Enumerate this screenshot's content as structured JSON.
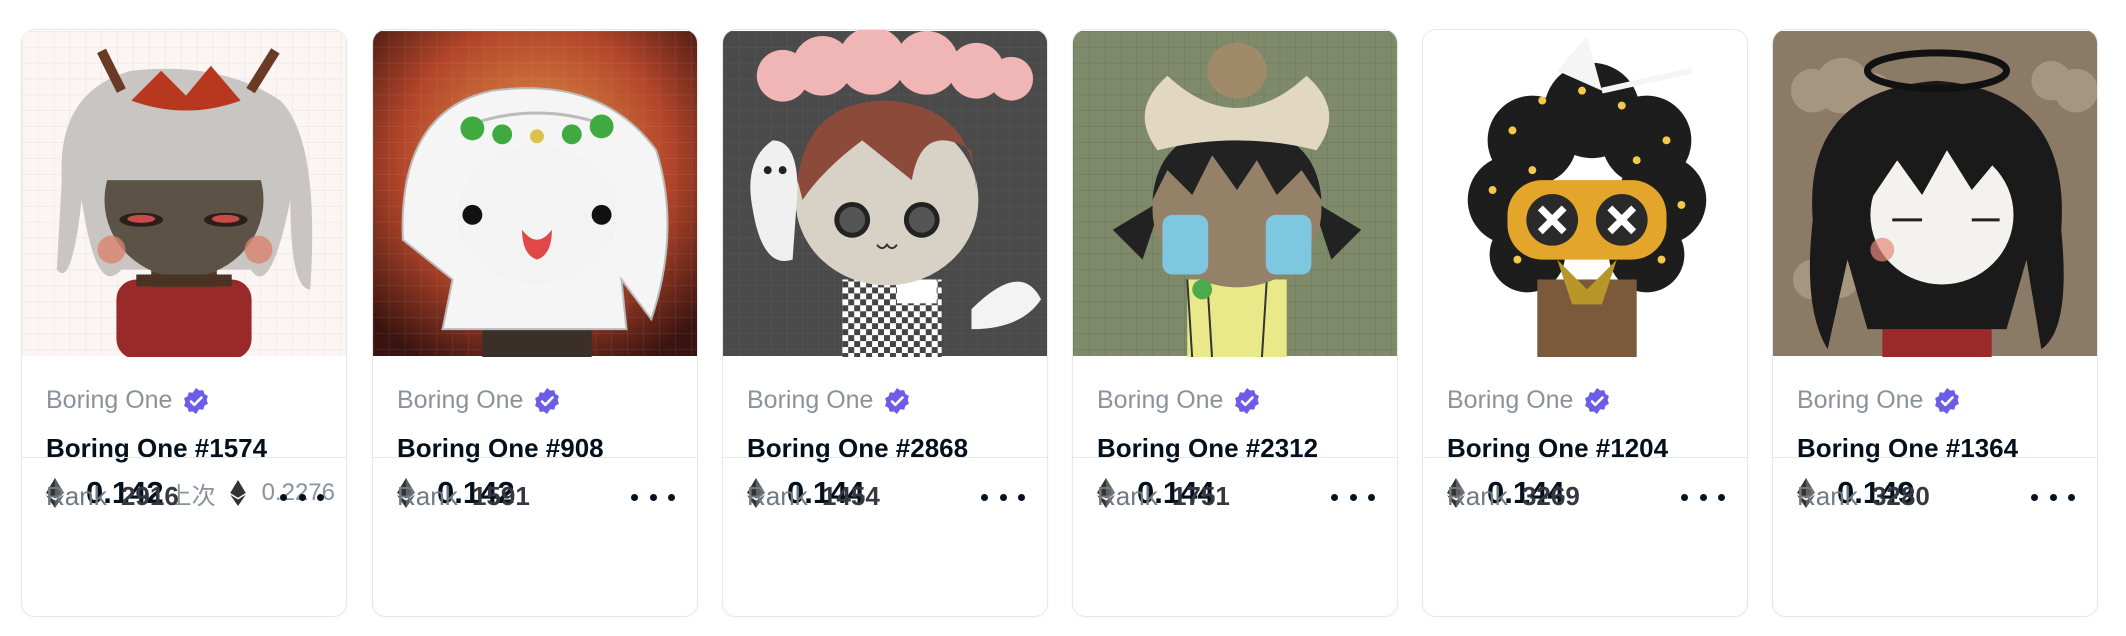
{
  "colors": {
    "verified_badge": "#6c5ce7",
    "text_primary": "#04111d",
    "text_secondary": "#8a939b",
    "border": "#e5e8eb"
  },
  "cards": [
    {
      "image_icon": "nft-avatar-maple-leaf-crown",
      "collection": "Boring One",
      "verified_icon": "verified-badge-icon",
      "name": "Boring One #1574",
      "price": "0.142",
      "last_sale_label": "上次",
      "last_sale_price": "0.2276",
      "rank_label": "Rank",
      "rank": "2916"
    },
    {
      "image_icon": "nft-avatar-clover-crown-white-hair",
      "collection": "Boring One",
      "verified_icon": "verified-badge-icon",
      "name": "Boring One #908",
      "price": "0.142",
      "rank_label": "Rank",
      "rank": "1591"
    },
    {
      "image_icon": "nft-avatar-rain-cloud-hat",
      "collection": "Boring One",
      "verified_icon": "verified-badge-icon",
      "name": "Boring One #2868",
      "price": "0.144",
      "rank_label": "Rank",
      "rank": "1454"
    },
    {
      "image_icon": "nft-avatar-bow-crying",
      "collection": "Boring One",
      "verified_icon": "verified-badge-icon",
      "name": "Boring One #2312",
      "price": "0.144",
      "rank_label": "Rank",
      "rank": "1751"
    },
    {
      "image_icon": "nft-avatar-star-afro-mask",
      "collection": "Boring One",
      "verified_icon": "verified-badge-icon",
      "name": "Boring One #1204",
      "price": "0.144",
      "rank_label": "Rank",
      "rank": "3269"
    },
    {
      "image_icon": "nft-avatar-halo-black-hair",
      "collection": "Boring One",
      "verified_icon": "verified-badge-icon",
      "name": "Boring One #1364",
      "price": "0.149",
      "rank_label": "Rank",
      "rank": "3280"
    }
  ]
}
